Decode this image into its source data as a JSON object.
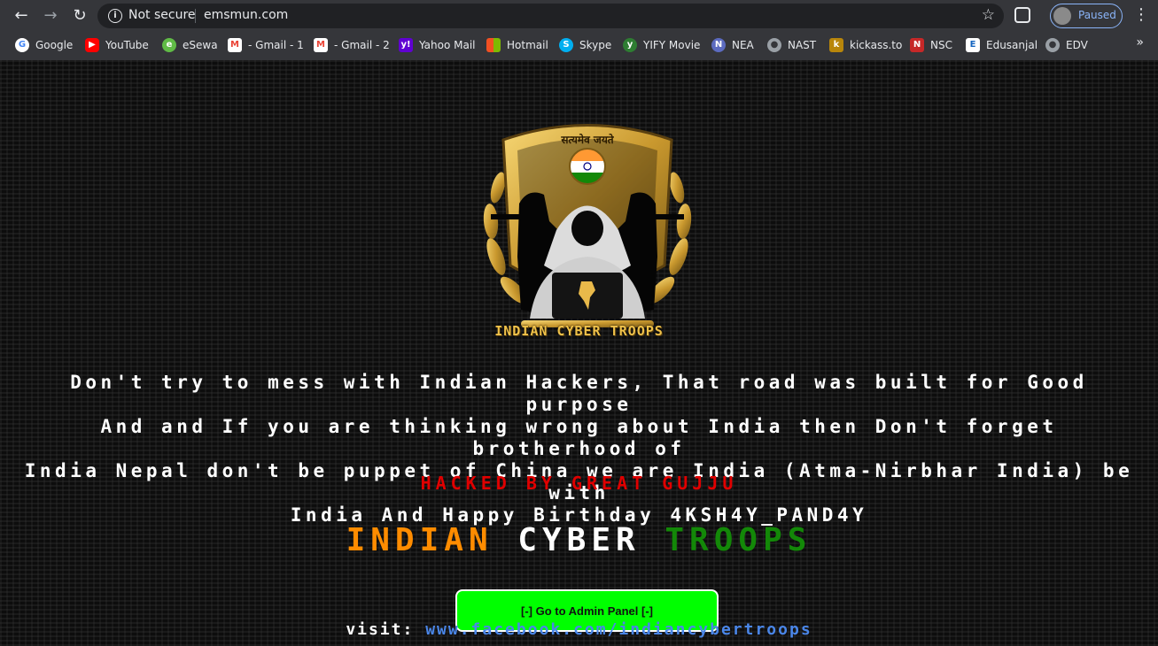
{
  "browser": {
    "omnibox": {
      "security": "Not secure",
      "url": "emsmun.com"
    },
    "profile": {
      "status": "Paused"
    },
    "bookmarks": [
      {
        "label": "Google",
        "icon": "google-icon",
        "color": "#4285f4"
      },
      {
        "label": "YouTube",
        "icon": "youtube-icon",
        "color": "#ff0000"
      },
      {
        "label": "eSewa",
        "icon": "esewa-icon",
        "color": "#60bb46"
      },
      {
        "label": "- Gmail - 1",
        "icon": "gmail-icon",
        "color": "#ea4335"
      },
      {
        "label": "- Gmail - 2",
        "icon": "gmail-icon",
        "color": "#ea4335"
      },
      {
        "label": "Yahoo Mail",
        "icon": "yahoo-icon",
        "color": "#6001d2"
      },
      {
        "label": "Hotmail",
        "icon": "microsoft-icon",
        "color": "#f25022"
      },
      {
        "label": "Skype",
        "icon": "skype-icon",
        "color": "#00aff0"
      },
      {
        "label": "YIFY Movie",
        "icon": "yify-icon",
        "color": "#2e7d32"
      },
      {
        "label": "NEA",
        "icon": "nea-icon",
        "color": "#5c6bc0"
      },
      {
        "label": "NAST",
        "icon": "globe-icon",
        "color": "#9aa0a6"
      },
      {
        "label": "kickass.to",
        "icon": "kickass-icon",
        "color": "#b8860b"
      },
      {
        "label": "NSC",
        "icon": "nsc-icon",
        "color": "#c62828"
      },
      {
        "label": "Edusanjal",
        "icon": "edusanjal-icon",
        "color": "#ffffff"
      },
      {
        "label": "EDV",
        "icon": "globe-icon",
        "color": "#9aa0a6"
      }
    ]
  },
  "page": {
    "emblem": {
      "motto": "सत्यमेव जयते",
      "caption": "INDIAN CYBER TROOPS"
    },
    "message_lines": [
      "Don't try to mess with Indian Hackers, That road was built for Good purpose",
      "And and If you are thinking wrong about India then Don't forget brotherhood of",
      "India Nepal don't be puppet of China we are India (Atma-Nirbhar India) be with",
      "India And Happy Birthday 4KSH4Y_PAND4Y"
    ],
    "hacked_by": "HACKED BY GREAT GUJJU",
    "group_name": {
      "word1": "INDIAN",
      "word2": "CYBER",
      "word3": "TROOPS"
    },
    "admin_button": "[-]   Go to Admin Panel   [-]",
    "visit_label": "visit:",
    "visit_link": "www.facebook.com/indiancybertroops"
  }
}
